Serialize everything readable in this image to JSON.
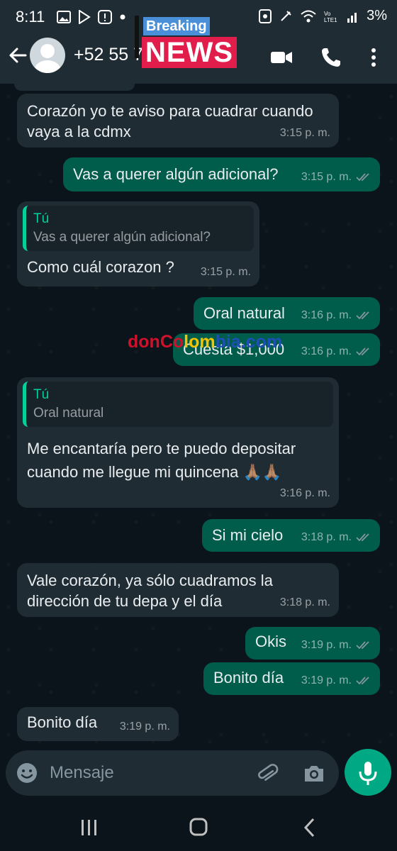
{
  "status_bar": {
    "time": "8:11",
    "battery": "3%",
    "left_icons": [
      "gallery-icon",
      "play-store-icon",
      "alert-icon",
      "dot-icon"
    ],
    "right_icons": [
      "nfc-icon",
      "mute-icon",
      "wifi-icon",
      "lte-icon",
      "signal-icon"
    ]
  },
  "header": {
    "contact": "+52 55 7",
    "icons": [
      "back-arrow-icon",
      "video-call-icon",
      "phone-icon",
      "more-icon"
    ]
  },
  "overlay": {
    "breaking": "Breaking",
    "news": "NEWS"
  },
  "watermark": {
    "part1": "donCo",
    "part2": "lom",
    "part3": "bia.com"
  },
  "messages": [
    {
      "dir": "in",
      "text": "Corazón yo te aviso para cuadrar cuando vaya a la cdmx",
      "time": "3:15 p. m."
    },
    {
      "dir": "out",
      "text": "Vas a querer algún adicional?",
      "time": "3:15 p. m."
    },
    {
      "dir": "in",
      "quote_name": "Tú",
      "quote_text": "Vas a querer algún adicional?",
      "text": "Como cuál corazon ?",
      "time": "3:15 p. m."
    },
    {
      "dir": "out",
      "text": "Oral natural",
      "time": "3:16 p. m."
    },
    {
      "dir": "out",
      "text": "Cuesta $1,000",
      "time": "3:16 p. m."
    },
    {
      "dir": "in",
      "quote_name": "Tú",
      "quote_text": "Oral natural",
      "text": "Me encantaría pero te puedo depositar cuando me llegue mi quincena 🙏🏽🙏🏽",
      "time": "3:16 p. m."
    },
    {
      "dir": "out",
      "text": "Si mi cielo",
      "time": "3:18 p. m."
    },
    {
      "dir": "in",
      "text": "Vale corazón, ya sólo cuadramos la dirección de tu depa y el día",
      "time": "3:18 p. m."
    },
    {
      "dir": "out",
      "text": "Okis",
      "time": "3:19 p. m."
    },
    {
      "dir": "out",
      "text": "Bonito día",
      "time": "3:19 p. m."
    },
    {
      "dir": "in",
      "text": "Bonito día",
      "time": "3:19 p. m."
    }
  ],
  "composer": {
    "placeholder": "Mensaje",
    "icons": [
      "emoji-icon",
      "attach-icon",
      "camera-icon",
      "mic-icon"
    ]
  },
  "colors": {
    "background": "#0b141a",
    "incoming": "#1f2c34",
    "outgoing": "#005c4b",
    "accent": "#00a884",
    "quote_accent": "#06cf9c"
  }
}
